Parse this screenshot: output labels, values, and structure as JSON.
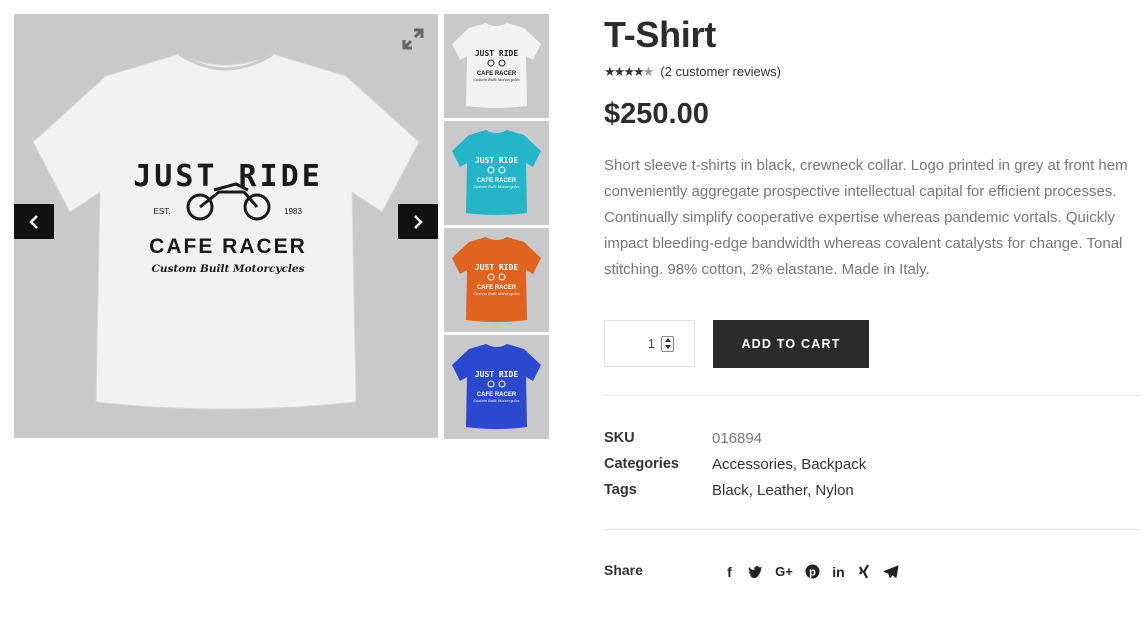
{
  "gallery": {
    "main_shirt_color": "#f2f2f2",
    "graphic": {
      "line1": "JUST RIDE",
      "est": "EST.",
      "year": "1983",
      "line2": "CAFE RACER",
      "line3": "Custom Built Motorcycles"
    },
    "thumbnails": [
      {
        "color": "#f2f2f2",
        "ink": "#222222"
      },
      {
        "color": "#25b5c9",
        "ink": "#ffffff"
      },
      {
        "color": "#e0621f",
        "ink": "#ffffff"
      },
      {
        "color": "#2a49cf",
        "ink": "#ffffff"
      }
    ],
    "icons": {
      "expand": "expand-icon",
      "prev": "chevron-left-icon",
      "next": "chevron-right-icon"
    }
  },
  "product": {
    "title": "T-Shirt",
    "rating": 4.5,
    "review_text": "(2 customer reviews)",
    "price": "$250.00",
    "description": "Short sleeve t-shirts in black, crewneck collar. Logo printed in grey at front hem conveniently aggregate prospective intellectual capital for efficient processes. Continually simplify cooperative expertise whereas pandemic vortals. Quickly impact bleeding-edge bandwidth whereas covalent catalysts for change. Tonal stitching. 98% cotton, 2% elastane. Made in Italy.",
    "quantity": "1",
    "add_to_cart": "ADD TO CART"
  },
  "meta": {
    "sku_label": "SKU",
    "sku_value": "016894",
    "categories_label": "Categories",
    "categories": [
      "Accessories",
      "Backpack"
    ],
    "tags_label": "Tags",
    "tags": [
      "Black",
      "Leather",
      "Nylon"
    ]
  },
  "share": {
    "label": "Share",
    "icons": [
      "facebook-icon",
      "twitter-icon",
      "google-plus-icon",
      "pinterest-icon",
      "linkedin-icon",
      "xing-icon",
      "telegram-icon"
    ]
  }
}
